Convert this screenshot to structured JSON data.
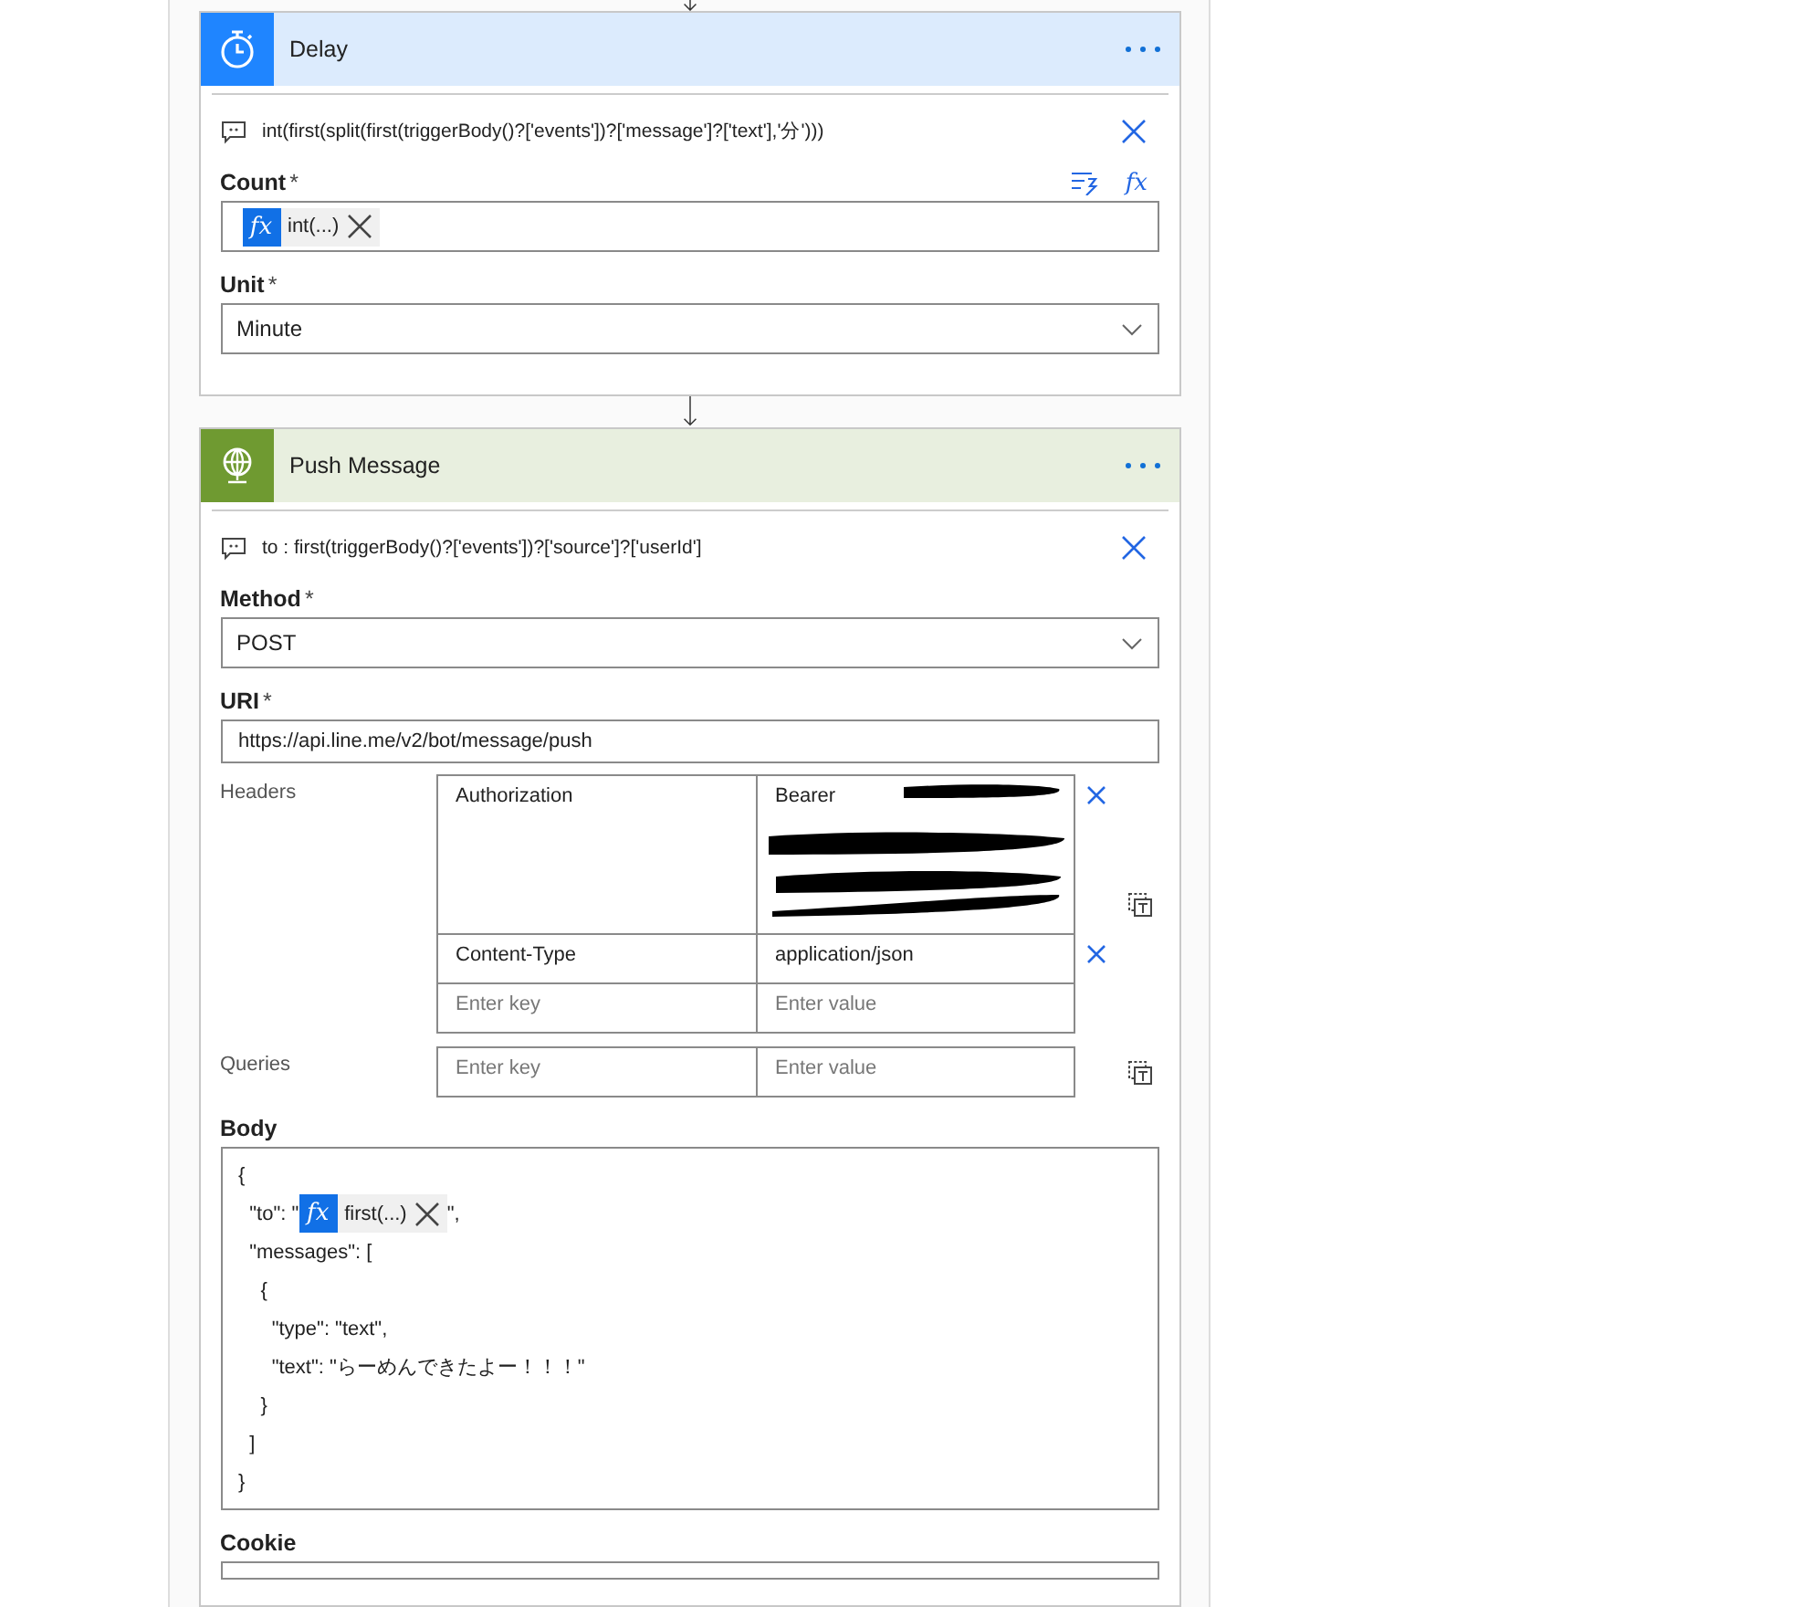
{
  "cards": [
    {
      "kind": "delay",
      "title": "Delay",
      "comment": "int(first(split(first(triggerBody()?['events'])?['message']?['text'],'分')))",
      "fields": [
        {
          "kind": "token",
          "label": "Count",
          "required_mark": "*",
          "fx_button": "fx",
          "token": {
            "icon_text": "fx",
            "text": "int(...)"
          }
        },
        {
          "kind": "dropdown",
          "label": "Unit",
          "required_mark": "*",
          "value": "Minute"
        }
      ]
    },
    {
      "kind": "http",
      "title": "Push Message",
      "comment": "to : first(triggerBody()?['events'])?['source']?['userId']",
      "fields": [
        {
          "kind": "dropdown",
          "label": "Method",
          "required_mark": "*",
          "value": "POST"
        },
        {
          "kind": "text",
          "label": "URI",
          "required_mark": "*",
          "value": "https://api.line.me/v2/bot/message/push"
        },
        {
          "kind": "table",
          "label": "Headers",
          "rows": [
            {
              "key": "Authorization",
              "value": "Bearer",
              "redacted": true,
              "removable": true
            },
            {
              "key": "Content-Type",
              "value": "application/json",
              "redacted": false,
              "removable": true
            },
            {
              "key_placeholder": "Enter key",
              "value_placeholder": "Enter value",
              "removable": false
            }
          ]
        },
        {
          "kind": "table",
          "label": "Queries",
          "rows": [
            {
              "key_placeholder": "Enter key",
              "value_placeholder": "Enter value",
              "removable": false
            }
          ]
        },
        {
          "kind": "code",
          "label": "Body",
          "lines": [
            {
              "text": "{"
            },
            {
              "text": "  \"to\": \"",
              "token": {
                "icon_text": "fx",
                "text": "first(...)"
              },
              "after": "\","
            },
            {
              "text": "  \"messages\": ["
            },
            {
              "text": "    {"
            },
            {
              "text": "      \"type\": \"text\","
            },
            {
              "text": "      \"text\": \"らーめんできたよー！！！\""
            },
            {
              "text": "    }"
            },
            {
              "text": "  ]"
            },
            {
              "text": "}"
            }
          ]
        },
        {
          "kind": "cutoff",
          "label": "Cookie"
        }
      ]
    }
  ]
}
